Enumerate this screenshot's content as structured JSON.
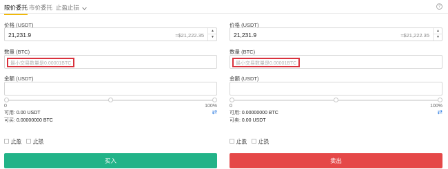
{
  "tabs": {
    "limit": "限价委托",
    "market": "市价委托",
    "stop": "止盈止损"
  },
  "buy": {
    "price_label": "价格 (USDT)",
    "price_value": "21,231.9",
    "price_conv": "≈$21,222.35",
    "amount_label": "数量 (BTC)",
    "amount_placeholder": "最小交易数量是0.00001BTC",
    "total_label": "金额 (USDT)",
    "slider_min": "0",
    "slider_max": "100%",
    "slider_percent": 0,
    "available_label": "可用:",
    "available_value": "0.00 USDT",
    "can_buy_label": "可买:",
    "can_buy_value": "0.00000000 BTC",
    "take_profit": "止盈",
    "stop_loss": "止损",
    "submit": "买入"
  },
  "sell": {
    "price_label": "价格 (USDT)",
    "price_value": "21,231.9",
    "price_conv": "≈$21,222.35",
    "amount_label": "数量 (BTC)",
    "amount_placeholder": "最小交易数量是0.00001BTC",
    "total_label": "金额 (USDT)",
    "slider_min": "0",
    "slider_max": "100%",
    "slider_percent": 0,
    "available_label": "可用:",
    "available_value": "0.00000000 BTC",
    "can_sell_label": "可卖:",
    "can_sell_value": "0.00 USDT",
    "take_profit": "止盈",
    "stop_loss": "止损",
    "submit": "卖出"
  },
  "colors": {
    "buy": "#22b388",
    "sell": "#e54848",
    "highlight": "#d9323d",
    "accent": "#f0b90b"
  },
  "icons": {
    "help": "help-icon",
    "dropdown": "chevron-down-icon",
    "swap": "swap-arrows-icon",
    "step_up": "caret-up-icon",
    "step_down": "caret-down-icon"
  }
}
